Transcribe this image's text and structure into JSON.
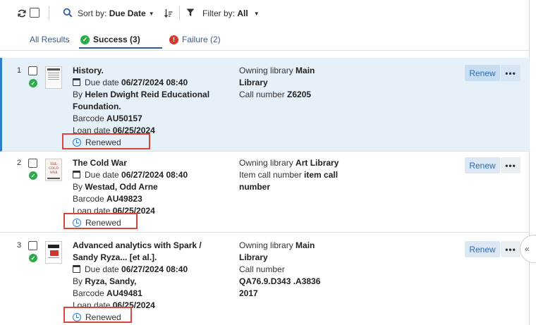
{
  "toolbar": {
    "sort_prefix": "Sort by:",
    "sort_value": "Due Date",
    "filter_prefix": "Filter by:",
    "filter_value": "All"
  },
  "tabs": {
    "all": "All Results",
    "success": "Success (3)",
    "failure": "Failure (2)"
  },
  "rows": [
    {
      "num": "1",
      "title": "History.",
      "due_label": "Due date",
      "due": "06/27/2024 08:40",
      "by_label": "By",
      "author": "Helen Dwight Reid Educational Foundation.",
      "barcode_label": "Barcode",
      "barcode": "AU50157",
      "loan_label": "Loan date",
      "loan": "06/25/2024",
      "status": "Renewed",
      "owning_label": "Owning library",
      "owning": "Main Library",
      "call_label": "Call number",
      "call": "Z6205",
      "renew": "Renew",
      "more": "•••"
    },
    {
      "num": "2",
      "title": "The Cold War",
      "due_label": "Due date",
      "due": "06/27/2024 08:40",
      "by_label": "By",
      "author": "Westad, Odd Arne",
      "barcode_label": "Barcode",
      "barcode": "AU49823",
      "loan_label": "Loan date",
      "loan": "06/25/2024",
      "status": "Renewed",
      "owning_label": "Owning library",
      "owning": "Art Library",
      "call_label": "Item call number",
      "call": "item call number",
      "renew": "Renew",
      "more": "•••"
    },
    {
      "num": "3",
      "title": "Advanced analytics with Spark / Sandy Ryza... [et al.].",
      "due_label": "Due date",
      "due": "06/27/2024 08:40",
      "by_label": "By",
      "author": "Ryza, Sandy,",
      "barcode_label": "Barcode",
      "barcode": "AU49481",
      "loan_label": "Loan date",
      "loan": "06/25/2024",
      "status": "Renewed",
      "owning_label": "Owning library",
      "owning": "Main Library",
      "call_label": "Call number",
      "call": "QA76.9.D343 .A3836 2017",
      "renew": "Renew",
      "more": "•••"
    }
  ],
  "thumb_text": {
    "cold_war": "THE COLD WAR"
  },
  "collapse": "«",
  "colors": {
    "accent": "#2c7cd0",
    "success": "#2eaa4a",
    "failure": "#d43a2f",
    "highlight_box": "#d9453a",
    "selected_row": "#e6f0f8"
  },
  "icons": {
    "refresh": "refresh-icon",
    "search": "search-icon",
    "sort_direction": "sort-direction-icon",
    "filter": "filter-icon",
    "calendar": "calendar-icon",
    "clock": "clock-icon",
    "check": "check-circle-icon",
    "error": "error-circle-icon"
  }
}
